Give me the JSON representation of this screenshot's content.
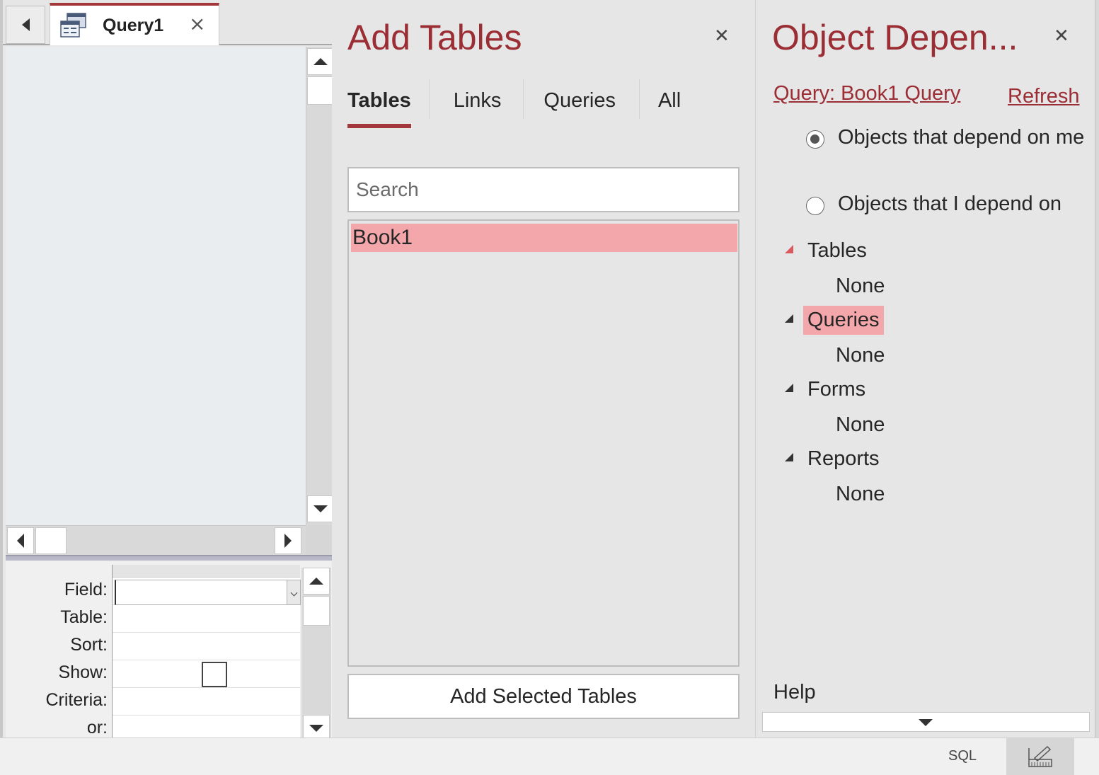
{
  "document_tab": {
    "label": "Query1"
  },
  "design_grid": {
    "row_labels": [
      "Field:",
      "Table:",
      "Sort:",
      "Show:",
      "Criteria:",
      "or:"
    ]
  },
  "add_tables": {
    "title": "Add Tables",
    "tabs": [
      "Tables",
      "Links",
      "Queries",
      "All"
    ],
    "active_tab": "Tables",
    "search_placeholder": "Search",
    "items": [
      "Book1"
    ],
    "add_button": "Add Selected Tables"
  },
  "object_dependencies": {
    "title": "Object Depen...",
    "object_link": "Query: Book1 Query",
    "refresh_label": "Refresh",
    "radio_options": [
      "Objects that depend on me",
      "Objects that I depend on"
    ],
    "selected_radio": 0,
    "tree": [
      {
        "label": "Tables",
        "child": "None"
      },
      {
        "label": "Queries",
        "child": "None"
      },
      {
        "label": "Forms",
        "child": "None"
      },
      {
        "label": "Reports",
        "child": "None"
      }
    ],
    "help_label": "Help"
  },
  "statusbar": {
    "sql_label": "SQL"
  },
  "colors": {
    "accent": "#a4373a",
    "title": "#9b2d35",
    "selection": "#f4a7aa"
  }
}
